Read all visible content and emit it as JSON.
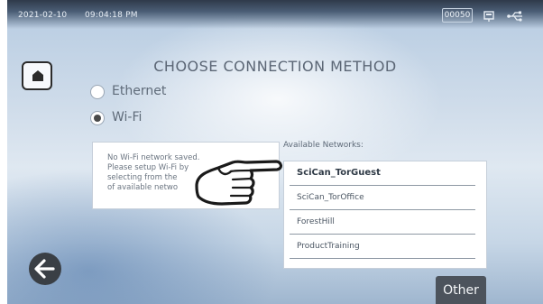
{
  "status": {
    "date": "2021-02-10",
    "time": "09:04:18 PM",
    "counter": "00050",
    "icons": [
      "display-icon",
      "usb-icon"
    ]
  },
  "header": {
    "home_icon": "home-icon",
    "title": "CHOOSE CONNECTION METHOD"
  },
  "connection": {
    "options": [
      {
        "label": "Ethernet",
        "selected": false
      },
      {
        "label": "Wi-Fi",
        "selected": true
      }
    ]
  },
  "message": {
    "lines": [
      "No Wi-Fi network saved.",
      "Please setup Wi-Fi by",
      "selecting from the",
      "of available netwo"
    ]
  },
  "networks": {
    "heading": "Available Networks:",
    "items": [
      {
        "name": "SciCan_TorGuest",
        "highlighted": true
      },
      {
        "name": "SciCan_TorOffice",
        "highlighted": false
      },
      {
        "name": "ForestHill",
        "highlighted": false
      },
      {
        "name": "ProductTraining",
        "highlighted": false
      }
    ]
  },
  "footer": {
    "back_icon": "back-arrow-icon",
    "other_label": "Other"
  },
  "overlay": {
    "pointer": "pointing-hand-icon"
  }
}
